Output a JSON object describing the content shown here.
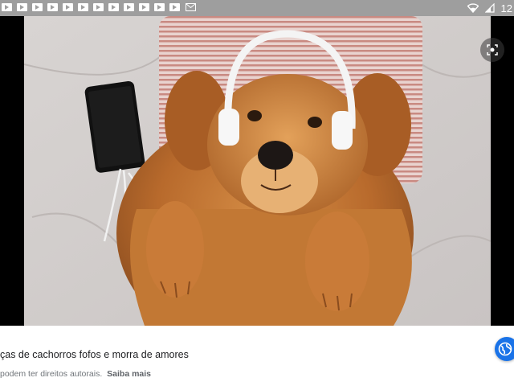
{
  "status_bar": {
    "time": "12",
    "notification_icons": [
      "video-notification-icon",
      "video-notification-icon",
      "video-notification-icon",
      "video-notification-icon",
      "video-notification-icon",
      "video-notification-icon",
      "video-notification-icon",
      "video-notification-icon",
      "video-notification-icon",
      "video-notification-icon",
      "video-notification-icon",
      "video-notification-icon"
    ],
    "extra_icon": "mail-icon",
    "wifi_icon": "wifi-icon",
    "signal_icon": "signal-icon"
  },
  "viewer": {
    "lens_icon": "lens-icon"
  },
  "caption": {
    "title": "ças de cachorros fofos e morra de amores",
    "copyright": "podem ter direitos autorais.",
    "learn_more": "Saiba mais",
    "visit_icon": "globe-icon"
  },
  "colors": {
    "status_bar": "#9e9e9e",
    "accent": "#1a73e8",
    "viewer_bg": "#000000"
  }
}
